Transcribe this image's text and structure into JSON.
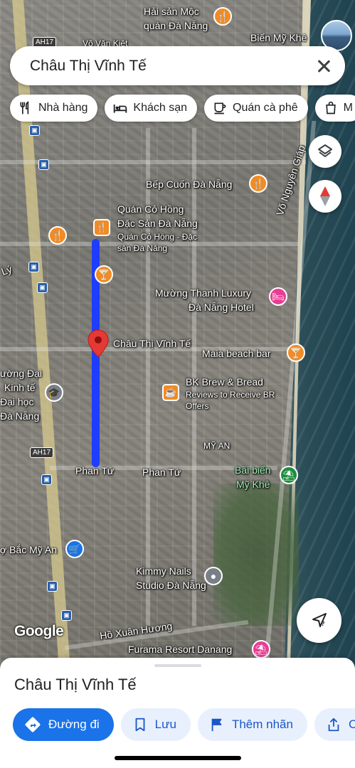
{
  "search": {
    "query": "Châu Thị Vĩnh Tế"
  },
  "chips": [
    {
      "label": "Nhà hàng",
      "icon": "restaurant-icon"
    },
    {
      "label": "Khách sạn",
      "icon": "hotel-icon"
    },
    {
      "label": "Quán cà phê",
      "icon": "coffee-icon"
    },
    {
      "label": "M",
      "icon": "shopping-bag-icon"
    }
  ],
  "map": {
    "places": {
      "hai_san_moc_1": "Hải sản Mộc",
      "hai_san_moc_2": "quán Đà Nẵng",
      "vo_van_kiet": "Võ Văn Kiệt",
      "bien_my_khe_top": "Biển Mỹ Khê",
      "bep_cuon": "Bếp Cuốn Đà Nẵng",
      "quan_co_hong_1": "Quán Cỏ Hồng",
      "quan_co_hong_2": "Đặc Sản Đà Nẵng",
      "quan_co_hong_sub_1": "Quán Cỏ Hồng - Đặc",
      "quan_co_hong_sub_2": "sản Đà Nẵng",
      "muong_thanh_1": "Mường Thanh Luxury",
      "muong_thanh_2": "Đà Nẵng Hotel",
      "chau_thi_vinh_te": "Châu Thị Vĩnh Tế",
      "maia": "Maia beach bar",
      "bk_brew": "BK Brew & Bread",
      "bk_sub_1": "Reviews to Receive BR",
      "bk_sub_2": "Offers",
      "my_an": "MỸ AN",
      "phan_tu_1": "Phan Tứ",
      "phan_tu_2": "Phan Tứ",
      "bai_bien_1": "Bãi biển",
      "bai_bien_2": "Mỹ Khê",
      "truong_1": "ường Đại",
      "truong_2": "Kinh tế",
      "truong_3": "Đại học",
      "truong_4": "Đà Nẵng",
      "bac_my_an": "ợ Bắc Mỹ An",
      "kimmy_1": "Kimmy Nails",
      "kimmy_2": "Studio Đà Nẵng",
      "ho_xuan_huong": "Hồ Xuân Hương",
      "furama": "Furama Resort Danang",
      "vo_nguyen_giap": "Võ Nguyên Giáp",
      "ly": "Lý"
    },
    "route_shields": {
      "ah17_top": "AH17",
      "ah17_mid": "AH17"
    },
    "logo": "Google",
    "colors": {
      "route": "#1f3dff",
      "orange_poi": "#f28b24",
      "pink_poi": "#e93d94",
      "green_poi": "#1e8e3e",
      "blue_poi": "#1a73e8"
    }
  },
  "sheet": {
    "title": "Châu Thị Vĩnh Tế",
    "actions": [
      {
        "label": "Đường đi",
        "icon": "directions-icon"
      },
      {
        "label": "Lưu",
        "icon": "bookmark-icon"
      },
      {
        "label": "Thêm nhãn",
        "icon": "flag-icon"
      },
      {
        "label": "C",
        "icon": "share-icon"
      }
    ]
  }
}
